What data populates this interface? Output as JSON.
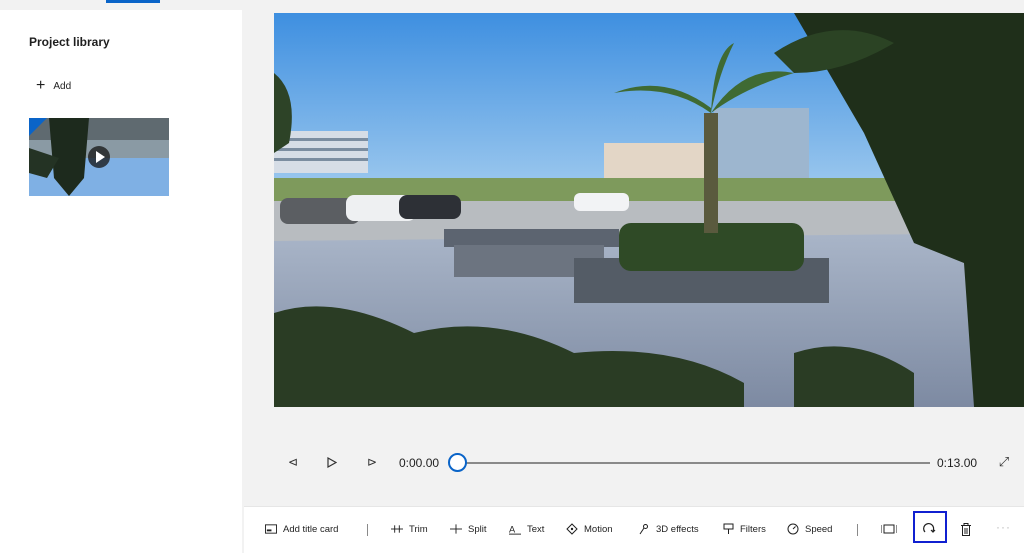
{
  "library": {
    "title": "Project library",
    "add_label": "Add"
  },
  "playback": {
    "current_time": "0:00.00",
    "total_time": "0:13.00",
    "progress": 0.0
  },
  "toolbar": {
    "add_title_card": "Add title card",
    "trim": "Trim",
    "split": "Split",
    "text": "Text",
    "motion": "Motion",
    "effects_3d": "3D effects",
    "filters": "Filters",
    "speed": "Speed"
  },
  "colors": {
    "accent": "#0a64c8",
    "highlight_box": "#1020d0"
  },
  "icons": {
    "add": "plus-icon",
    "step_back": "step-back-icon",
    "play": "play-icon",
    "step_forward": "step-forward-icon",
    "fullscreen": "expand-icon",
    "title_card": "title-card-icon",
    "trim": "trim-icon",
    "split": "split-icon",
    "text": "text-icon",
    "motion": "motion-icon",
    "effects_3d": "3d-effects-icon",
    "filters": "filters-icon",
    "speed": "speed-icon",
    "resize": "resize-icon",
    "rotate": "rotate-icon",
    "delete": "trash-icon",
    "more": "more-icon"
  }
}
